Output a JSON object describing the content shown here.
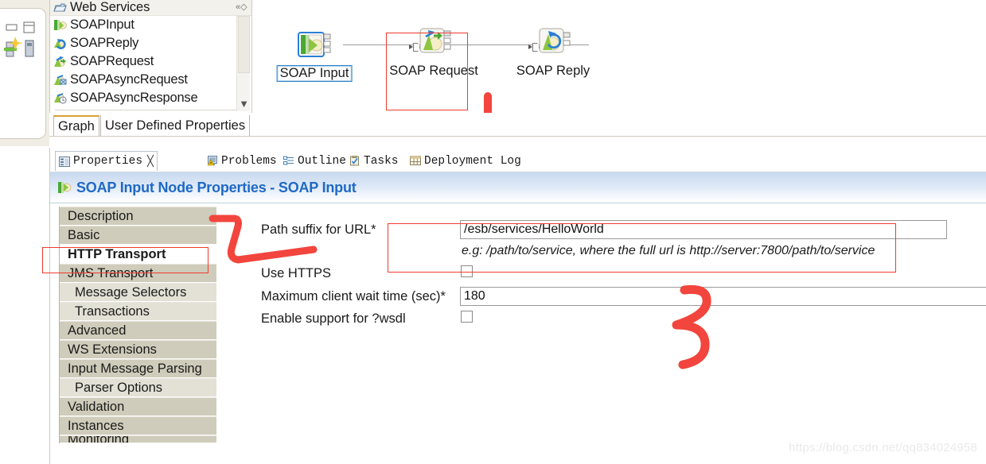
{
  "palette": {
    "title": "Web Services",
    "collapse_icon": "collapse-all-icon",
    "items": [
      {
        "label": "SOAPInput",
        "icon": "soap-input-icon"
      },
      {
        "label": "SOAPReply",
        "icon": "soap-reply-icon"
      },
      {
        "label": "SOAPRequest",
        "icon": "soap-request-icon"
      },
      {
        "label": "SOAPAsyncRequest",
        "icon": "soap-async-request-icon"
      },
      {
        "label": "SOAPAsyncResponse",
        "icon": "soap-async-response-icon"
      }
    ],
    "scroll_down_icon": "chevron-down-icon"
  },
  "editor_tabs": [
    {
      "label": "Graph",
      "active": true
    },
    {
      "label": "User Defined Properties",
      "active": false
    }
  ],
  "canvas": {
    "nodes": [
      {
        "label": "SOAP Input",
        "icon": "soap-input-node-icon",
        "selected": true
      },
      {
        "label": "SOAP Request",
        "icon": "soap-request-node-icon",
        "selected": false
      },
      {
        "label": "SOAP Reply",
        "icon": "soap-reply-node-icon",
        "selected": false
      }
    ]
  },
  "properties_view": {
    "tabs": [
      {
        "label": "Properties",
        "icon": "properties-icon",
        "active": true,
        "closeable": true
      },
      {
        "label": "Problems",
        "icon": "problems-icon",
        "active": false,
        "closeable": false
      },
      {
        "label": "Outline",
        "icon": "outline-icon",
        "active": false,
        "closeable": false
      },
      {
        "label": "Tasks",
        "icon": "tasks-icon",
        "active": false,
        "closeable": false
      },
      {
        "label": "Deployment Log",
        "icon": "deployment-icon",
        "active": false,
        "closeable": false
      }
    ],
    "title": "SOAP Input Node Properties - SOAP Input",
    "title_icon": "soap-input-icon",
    "title_color": "#1f69c4",
    "list": [
      {
        "label": "Description",
        "level": 0,
        "selected": false
      },
      {
        "label": "Basic",
        "level": 0,
        "selected": false
      },
      {
        "label": "HTTP Transport",
        "level": 0,
        "selected": true
      },
      {
        "label": "JMS Transport",
        "level": 0,
        "selected": false
      },
      {
        "label": "Message Selectors",
        "level": 1,
        "selected": false
      },
      {
        "label": "Transactions",
        "level": 1,
        "selected": false
      },
      {
        "label": "Advanced",
        "level": 0,
        "selected": false
      },
      {
        "label": "WS Extensions",
        "level": 0,
        "selected": false
      },
      {
        "label": "Input Message Parsing",
        "level": 0,
        "selected": false
      },
      {
        "label": "Parser Options",
        "level": 1,
        "selected": false
      },
      {
        "label": "Validation",
        "level": 0,
        "selected": false
      },
      {
        "label": "Instances",
        "level": 0,
        "selected": false
      },
      {
        "label": "Monitoring",
        "level": 0,
        "selected": false
      }
    ],
    "fields": {
      "path_suffix": {
        "label": "Path suffix for URL*",
        "value": "/esb/services/HelloWorld",
        "hint": "e.g: /path/to/service, where the full url is http://server:7800/path/to/service"
      },
      "use_https": {
        "label": "Use HTTPS",
        "checked": false
      },
      "max_wait": {
        "label": "Maximum client wait time (sec)*",
        "value": "180"
      },
      "wsdl": {
        "label": "Enable support for ?wsdl",
        "checked": false
      }
    }
  },
  "annotations": {
    "accent_color": "#ef3b30",
    "marks": [
      {
        "name": "soap-input-highlight-box",
        "shape": "rectangle"
      },
      {
        "name": "vertical-bar-mark",
        "shape": "bar"
      },
      {
        "name": "http-transport-highlight-box",
        "shape": "rectangle"
      },
      {
        "name": "arrow-to-path-suffix",
        "shape": "arrow"
      },
      {
        "name": "path-suffix-highlight-box",
        "shape": "rectangle"
      },
      {
        "name": "curly-three-mark",
        "shape": "squiggle"
      }
    ]
  },
  "watermark": "https://blog.csdn.net/qq834024958"
}
